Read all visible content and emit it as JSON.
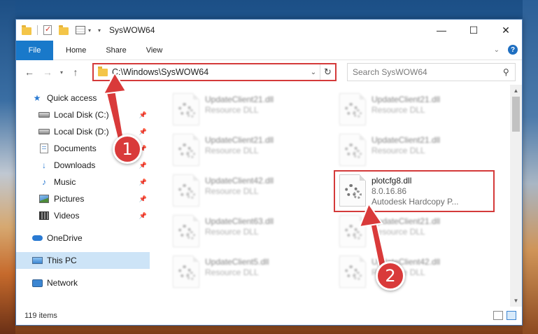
{
  "window": {
    "title": "SysWOW64",
    "controls": {
      "minimize": "—",
      "maximize": "☐",
      "close": "✕"
    }
  },
  "ribbon": {
    "tabs": [
      "File",
      "Home",
      "Share",
      "View"
    ],
    "help": "?"
  },
  "address": {
    "path": "C:\\Windows\\SysWOW64",
    "refresh": "↻"
  },
  "search": {
    "placeholder": "Search SysWOW64",
    "icon": "⚲"
  },
  "sidebar": {
    "items": [
      {
        "label": "Quick access",
        "icon": "star-icon",
        "pinned": false
      },
      {
        "label": "Local Disk (C:)",
        "icon": "drive-icon",
        "pinned": true
      },
      {
        "label": "Local Disk (D:)",
        "icon": "drive-icon",
        "pinned": true
      },
      {
        "label": "Documents",
        "icon": "documents-icon",
        "pinned": true
      },
      {
        "label": "Downloads",
        "icon": "download-icon",
        "pinned": true
      },
      {
        "label": "Music",
        "icon": "music-icon",
        "pinned": true
      },
      {
        "label": "Pictures",
        "icon": "pictures-icon",
        "pinned": true
      },
      {
        "label": "Videos",
        "icon": "videos-icon",
        "pinned": true
      },
      {
        "label": "OneDrive",
        "icon": "cloud-icon"
      },
      {
        "label": "This PC",
        "icon": "computer-icon",
        "selected": true
      },
      {
        "label": "Network",
        "icon": "network-icon"
      }
    ]
  },
  "files": [
    {
      "name": "UpdateClient21.dll",
      "type": "Resource DLL",
      "blurred": true
    },
    {
      "name": "UpdateClient21.dll",
      "type": "Resource DLL",
      "blurred": true
    },
    {
      "name": "UpdateClient21.dll",
      "type": "Resource DLL",
      "blurred": true
    },
    {
      "name": "UpdateClient21.dll",
      "type": "Resource DLL",
      "blurred": true
    },
    {
      "name": "UpdateClient42.dll",
      "type": "Resource DLL",
      "blurred": true
    },
    {
      "name": "plotcfg8.dll",
      "version": "8.0.16.86",
      "description": "Autodesk Hardcopy P...",
      "highlighted": true
    },
    {
      "name": "UpdateClient63.dll",
      "type": "Resource DLL",
      "blurred": true
    },
    {
      "name": "UpdateClient21.dll",
      "type": "Resource DLL",
      "blurred": true
    },
    {
      "name": "UpdateClient5.dll",
      "type": "Resource DLL",
      "blurred": true
    },
    {
      "name": "UpdateClient42.dll",
      "type": "Resource DLL",
      "blurred": true
    }
  ],
  "status": {
    "item_count": "119 items"
  },
  "annotations": {
    "step1": "1",
    "step2": "2"
  },
  "colors": {
    "accent": "#1979ca",
    "highlight": "#d43a3a",
    "selected": "#cde4f7"
  }
}
